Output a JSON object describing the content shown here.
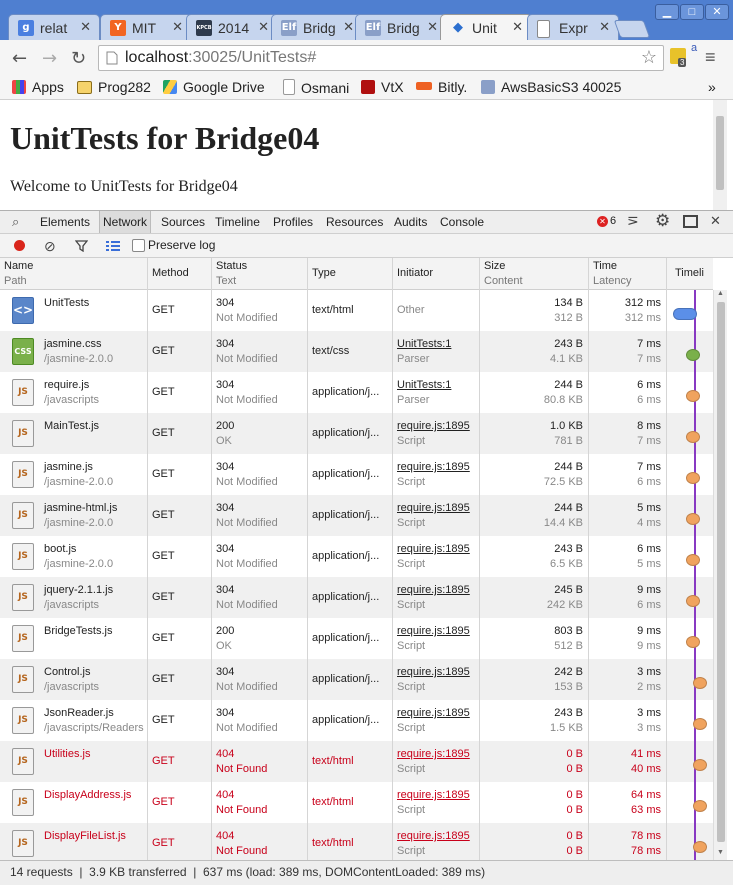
{
  "tabs": [
    {
      "label": "relat",
      "icon": "google-icon",
      "color": "#4a7fe0",
      "glyph": "g",
      "active": false
    },
    {
      "label": "MIT",
      "icon": "hacker-news-icon",
      "color": "#f26522",
      "glyph": "Y",
      "active": false
    },
    {
      "label": "2014",
      "icon": "kpcb-icon",
      "color": "#2e3a4c",
      "glyph": "KPCB",
      "active": false
    },
    {
      "label": "Bridg",
      "icon": "elf-icon",
      "color": "#8a9fc8",
      "glyph": "Elf",
      "active": false
    },
    {
      "label": "Bridg",
      "icon": "elf-icon",
      "color": "#8a9fc8",
      "glyph": "Elf",
      "active": false
    },
    {
      "label": "Unit",
      "icon": "devtools-icon",
      "color": "#2c6fcf",
      "glyph": "◆",
      "active": true
    },
    {
      "label": "Expr",
      "icon": "page-icon",
      "color": "#ffffff",
      "glyph": "",
      "active": false
    }
  ],
  "toolbar": {
    "url_host": "localhost",
    "url_rest": ":30025/UnitTests#",
    "ext_badge": "3"
  },
  "bookmarks": [
    "Apps",
    "Prog282",
    "Google Drive",
    "Osmani",
    "VtX",
    "Bitly.",
    "AwsBasicS3 40025"
  ],
  "bookmark_more": "»",
  "page": {
    "heading": "UnitTests for Bridge04",
    "welcome": "Welcome to UnitTests for Bridge04"
  },
  "devtools": {
    "tabs": [
      "Elements",
      "Network",
      "Sources",
      "Timeline",
      "Profiles",
      "Resources",
      "Audits",
      "Console"
    ],
    "active_tab": "Network",
    "error_count": "6",
    "preserve_log": "Preserve log"
  },
  "columns": {
    "name": "Name",
    "path": "Path",
    "method": "Method",
    "status": "Status",
    "text": "Text",
    "type": "Type",
    "initiator": "Initiator",
    "size": "Size",
    "content": "Content",
    "time": "Time",
    "latency": "Latency",
    "timeline": "Timeli"
  },
  "rows": [
    {
      "name": "UnitTests",
      "path": "",
      "method": "GET",
      "status": "304",
      "text": "Not Modified",
      "type": "text/html",
      "initiator": "Other",
      "init_sub": "",
      "size": "134 B",
      "content": "312 B",
      "time": "312 ms",
      "latency": "312 ms",
      "icon": "html",
      "error": false
    },
    {
      "name": "jasmine.css",
      "path": "/jasmine-2.0.0",
      "method": "GET",
      "status": "304",
      "text": "Not Modified",
      "type": "text/css",
      "initiator": "UnitTests:1",
      "init_sub": "Parser",
      "size": "243 B",
      "content": "4.1 KB",
      "time": "7 ms",
      "latency": "7 ms",
      "icon": "css",
      "error": false
    },
    {
      "name": "require.js",
      "path": "/javascripts",
      "method": "GET",
      "status": "304",
      "text": "Not Modified",
      "type": "application/j...",
      "initiator": "UnitTests:1",
      "init_sub": "Parser",
      "size": "244 B",
      "content": "80.8 KB",
      "time": "6 ms",
      "latency": "6 ms",
      "icon": "js",
      "error": false
    },
    {
      "name": "MainTest.js",
      "path": "",
      "method": "GET",
      "status": "200",
      "text": "OK",
      "type": "application/j...",
      "initiator": "require.js:1895",
      "init_sub": "Script",
      "size": "1.0 KB",
      "content": "781 B",
      "time": "8 ms",
      "latency": "7 ms",
      "icon": "js",
      "error": false
    },
    {
      "name": "jasmine.js",
      "path": "/jasmine-2.0.0",
      "method": "GET",
      "status": "304",
      "text": "Not Modified",
      "type": "application/j...",
      "initiator": "require.js:1895",
      "init_sub": "Script",
      "size": "244 B",
      "content": "72.5 KB",
      "time": "7 ms",
      "latency": "6 ms",
      "icon": "js",
      "error": false
    },
    {
      "name": "jasmine-html.js",
      "path": "/jasmine-2.0.0",
      "method": "GET",
      "status": "304",
      "text": "Not Modified",
      "type": "application/j...",
      "initiator": "require.js:1895",
      "init_sub": "Script",
      "size": "244 B",
      "content": "14.4 KB",
      "time": "5 ms",
      "latency": "4 ms",
      "icon": "js",
      "error": false
    },
    {
      "name": "boot.js",
      "path": "/jasmine-2.0.0",
      "method": "GET",
      "status": "304",
      "text": "Not Modified",
      "type": "application/j...",
      "initiator": "require.js:1895",
      "init_sub": "Script",
      "size": "243 B",
      "content": "6.5 KB",
      "time": "6 ms",
      "latency": "5 ms",
      "icon": "js",
      "error": false
    },
    {
      "name": "jquery-2.1.1.js",
      "path": "/javascripts",
      "method": "GET",
      "status": "304",
      "text": "Not Modified",
      "type": "application/j...",
      "initiator": "require.js:1895",
      "init_sub": "Script",
      "size": "245 B",
      "content": "242 KB",
      "time": "9 ms",
      "latency": "6 ms",
      "icon": "js",
      "error": false
    },
    {
      "name": "BridgeTests.js",
      "path": "",
      "method": "GET",
      "status": "200",
      "text": "OK",
      "type": "application/j...",
      "initiator": "require.js:1895",
      "init_sub": "Script",
      "size": "803 B",
      "content": "512 B",
      "time": "9 ms",
      "latency": "9 ms",
      "icon": "js",
      "error": false
    },
    {
      "name": "Control.js",
      "path": "/javascripts",
      "method": "GET",
      "status": "304",
      "text": "Not Modified",
      "type": "application/j...",
      "initiator": "require.js:1895",
      "init_sub": "Script",
      "size": "242 B",
      "content": "153 B",
      "time": "3 ms",
      "latency": "2 ms",
      "icon": "js",
      "error": false
    },
    {
      "name": "JsonReader.js",
      "path": "/javascripts/Readers",
      "method": "GET",
      "status": "304",
      "text": "Not Modified",
      "type": "application/j...",
      "initiator": "require.js:1895",
      "init_sub": "Script",
      "size": "243 B",
      "content": "1.5 KB",
      "time": "3 ms",
      "latency": "3 ms",
      "icon": "js",
      "error": false
    },
    {
      "name": "Utilities.js",
      "path": "",
      "method": "GET",
      "status": "404",
      "text": "Not Found",
      "type": "text/html",
      "initiator": "require.js:1895",
      "init_sub": "Script",
      "size": "0 B",
      "content": "0 B",
      "time": "41 ms",
      "latency": "40 ms",
      "icon": "js",
      "error": true
    },
    {
      "name": "DisplayAddress.js",
      "path": "",
      "method": "GET",
      "status": "404",
      "text": "Not Found",
      "type": "text/html",
      "initiator": "require.js:1895",
      "init_sub": "Script",
      "size": "0 B",
      "content": "0 B",
      "time": "64 ms",
      "latency": "63 ms",
      "icon": "js",
      "error": true
    },
    {
      "name": "DisplayFileList.js",
      "path": "",
      "method": "GET",
      "status": "404",
      "text": "Not Found",
      "type": "text/html",
      "initiator": "require.js:1895",
      "init_sub": "Script",
      "size": "0 B",
      "content": "0 B",
      "time": "78 ms",
      "latency": "78 ms",
      "icon": "js",
      "error": true
    }
  ],
  "status_bar": "14 requests  |  3.9 KB transferred  |  637 ms (load: 389 ms, DOMContentLoaded: 389 ms)",
  "colors": {
    "error_red": "#c8001a",
    "dom_line": "#8839c2",
    "dot_html": "#5b8fe8",
    "dot_css": "#7ab04a",
    "dot_js": "#f0a35e"
  }
}
